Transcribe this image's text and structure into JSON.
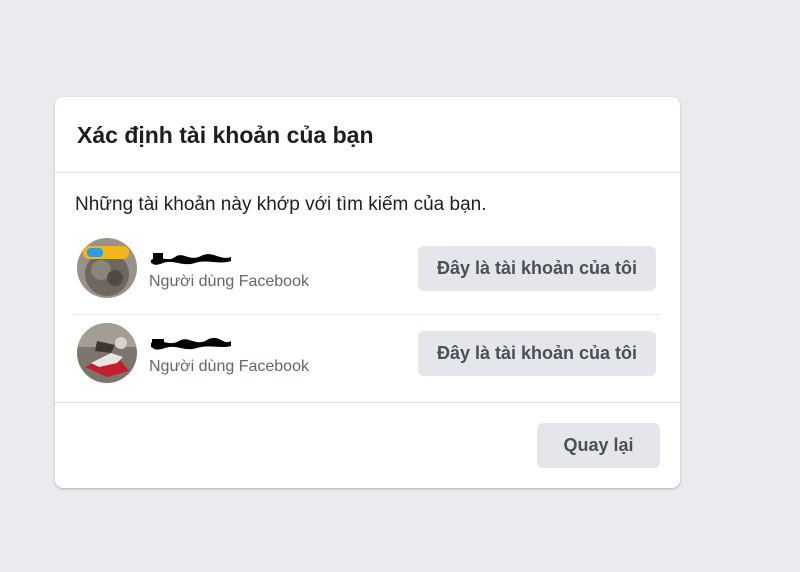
{
  "dialog": {
    "title": "Xác định tài khoản của bạn",
    "intro": "Những tài khoản này khớp với tìm kiếm của bạn."
  },
  "accounts": [
    {
      "subtitle": "Người dùng Facebook",
      "action_label": "Đây là tài khoản của tôi"
    },
    {
      "subtitle": "Người dùng Facebook",
      "action_label": "Đây là tài khoản của tôi"
    }
  ],
  "footer": {
    "back_label": "Quay lại"
  },
  "colors": {
    "page_background": "#e9ebee",
    "card_background": "#ffffff",
    "title_text": "#1c1e21",
    "secondary_text": "#606770",
    "button_background": "#e4e6eb",
    "button_text": "#4b4f56"
  }
}
